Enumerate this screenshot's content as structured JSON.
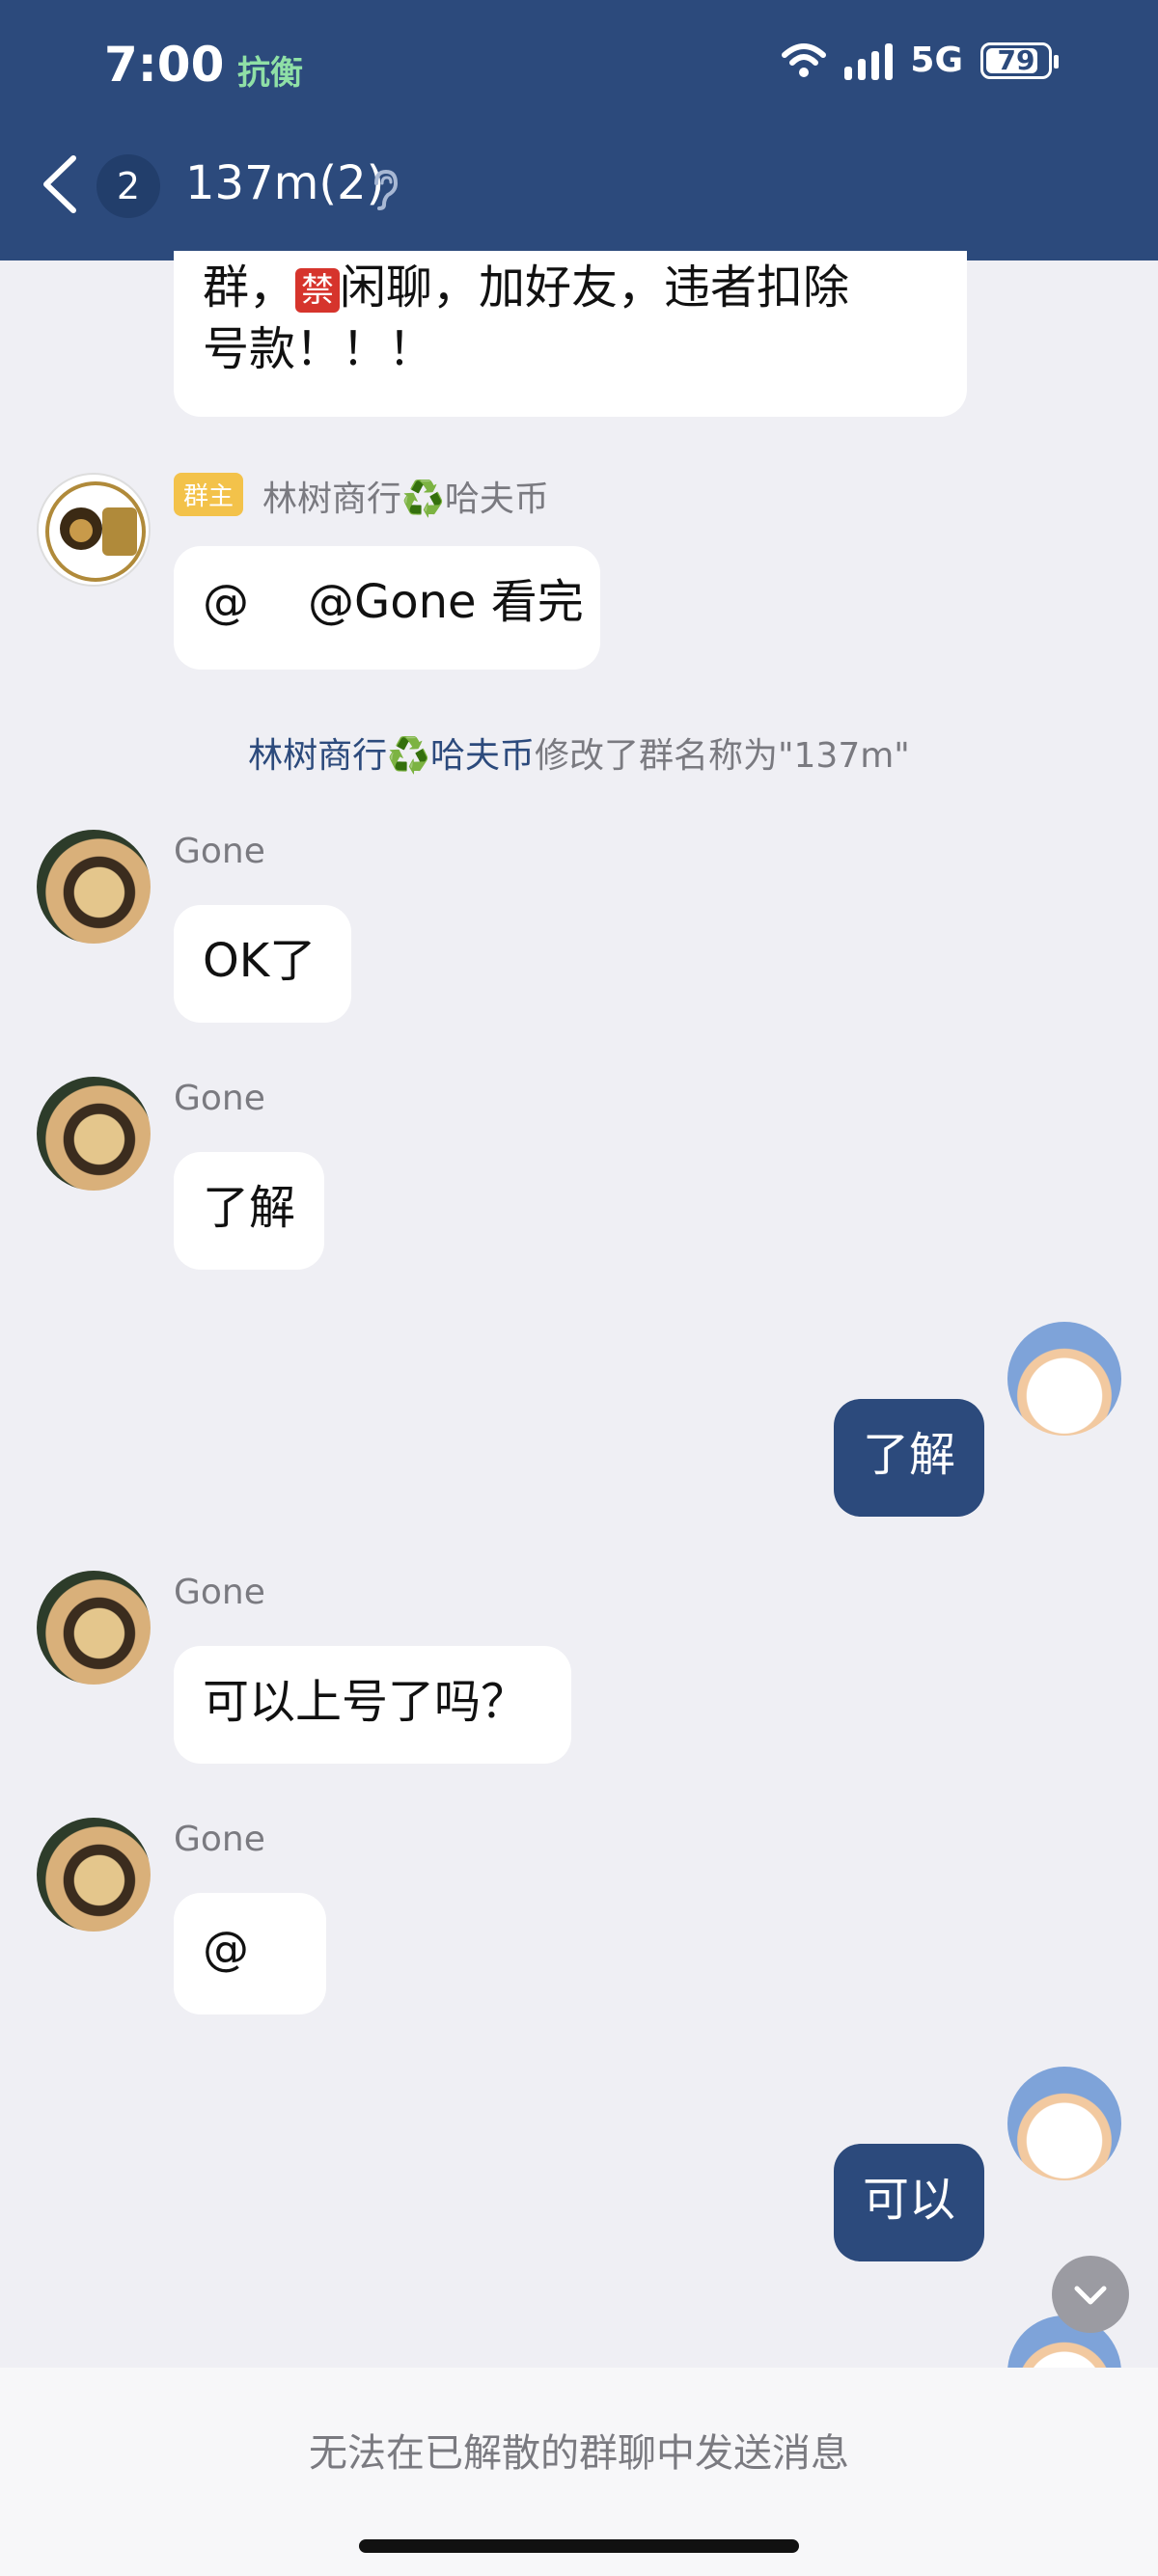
{
  "status_bar": {
    "time": "7:00",
    "carrier": "抗衡",
    "network": "5G",
    "battery": "79"
  },
  "header": {
    "back_badge": "2",
    "title": "137m(2)"
  },
  "messages": [
    {
      "line1_prefix": "群，",
      "forbidden_emoji": "禁",
      "line1_suffix": "闲聊，加好友，违者扣除",
      "line2": "号款！！！"
    },
    {
      "role_tag": "群主",
      "sender": "林树商行♻️哈夫币",
      "text": "@    @Gone 看完"
    },
    {
      "system_highlight": "林树商行♻️哈夫币",
      "system_text": "修改了群名称为\"137m\""
    },
    {
      "sender": "Gone",
      "text": "OK了"
    },
    {
      "sender": "Gone",
      "text": "了解"
    },
    {
      "text": "了解"
    },
    {
      "sender": "Gone",
      "text": "可以上号了吗？"
    },
    {
      "sender": "Gone",
      "text": "@"
    },
    {
      "text": "可以"
    }
  ],
  "footer": {
    "notice": "无法在已解散的群聊中发送消息"
  },
  "colors": {
    "header": "#2c4a7c",
    "background": "#efeff4",
    "my_bubble": "#2c4a7c"
  }
}
